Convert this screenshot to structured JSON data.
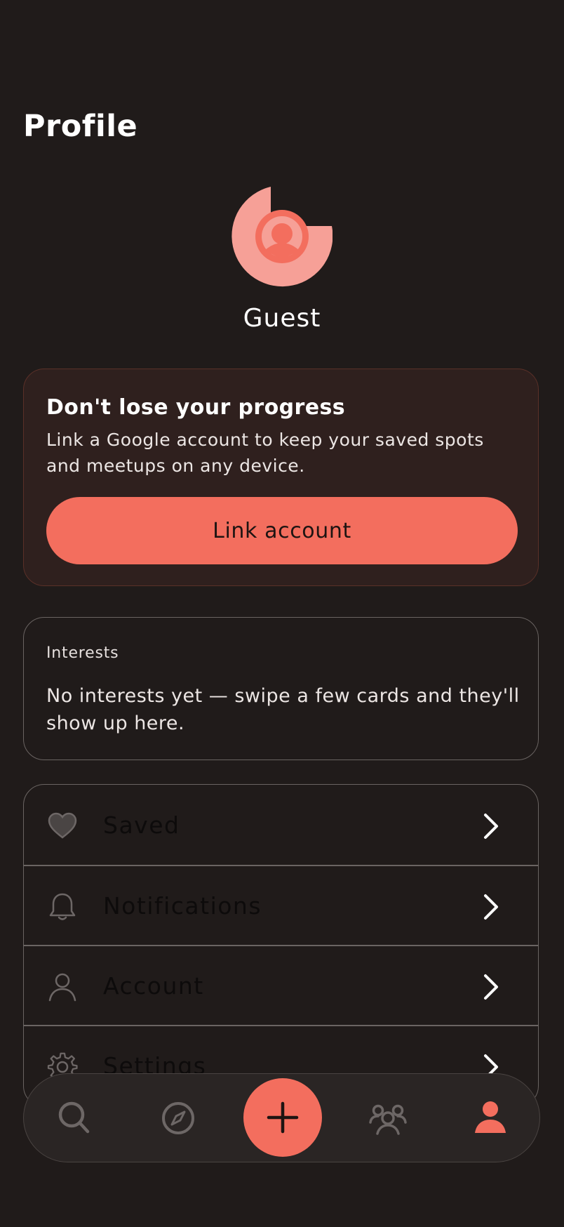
{
  "header": {
    "title": "Profile"
  },
  "profile": {
    "name": "Guest"
  },
  "link_card": {
    "title": "Don't lose your progress",
    "description": "Link a Google account to keep your saved spots and meetups on any device.",
    "button_label": "Link account"
  },
  "interests": {
    "label": "Interests",
    "empty_text": "No interests yet — swipe a few cards and they'll show up here."
  },
  "menu": {
    "items": [
      {
        "label": "Saved",
        "icon": "heart-icon"
      },
      {
        "label": "Notifications",
        "icon": "bell-icon"
      },
      {
        "label": "Account",
        "icon": "user-icon"
      },
      {
        "label": "Settings",
        "icon": "gear-icon"
      }
    ]
  },
  "bottom_nav": {
    "items": [
      {
        "icon": "search-icon",
        "active": false
      },
      {
        "icon": "compass-icon",
        "active": false
      },
      {
        "icon": "plus-icon",
        "active": false
      },
      {
        "icon": "group-icon",
        "active": false
      },
      {
        "icon": "profile-icon",
        "active": true
      }
    ]
  },
  "colors": {
    "background": "#201b1a",
    "accent": "#f36e5e",
    "card_tint": "#2f201e",
    "border": "#6a6462",
    "icon_muted": "#6d6766"
  }
}
